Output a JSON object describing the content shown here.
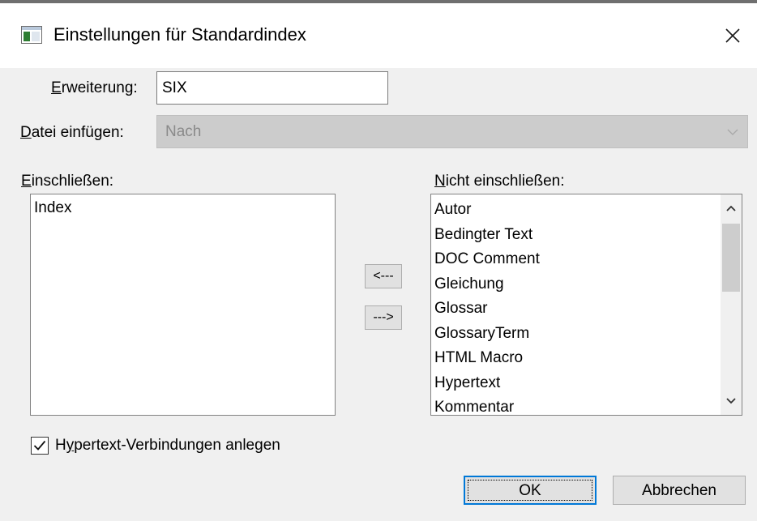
{
  "window": {
    "title": "Einstellungen für Standardindex",
    "close_icon": "close-icon"
  },
  "extension": {
    "label_accel": "E",
    "label_rest": "rweiterung:",
    "value": "SIX"
  },
  "insert_file": {
    "label_accel": "D",
    "label_rest": "atei einfügen:",
    "value": "Nach",
    "disabled": true
  },
  "include": {
    "label_accel": "E",
    "label_rest": "inschließen:",
    "items": [
      "Index"
    ]
  },
  "exclude": {
    "label_accel": "N",
    "label_rest": "icht einschließen:",
    "items": [
      "Autor",
      "Bedingter Text",
      "DOC Comment",
      "Gleichung",
      "Glossar",
      "GlossaryTerm",
      "HTML Macro",
      "Hypertext",
      "Kommentar"
    ]
  },
  "move_buttons": {
    "left_label": "<---",
    "right_label": "--->"
  },
  "hypertext": {
    "checked": true,
    "label_before": "H",
    "label_accel": "y",
    "label_rest": "pertext-Verbindungen anlegen"
  },
  "footer": {
    "ok_label": "OK",
    "cancel_label": "Abbrechen"
  }
}
